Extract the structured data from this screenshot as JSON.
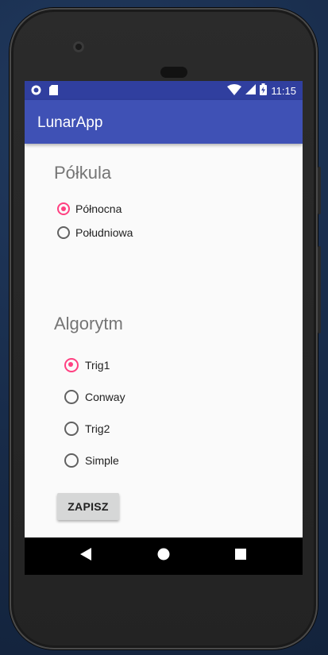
{
  "status_bar": {
    "time": "11:15",
    "left_icons": [
      "record-icon",
      "sd-card-icon"
    ],
    "right_icons": [
      "wifi-icon",
      "cell-signal-icon",
      "battery-icon"
    ]
  },
  "app_bar": {
    "title": "LunarApp",
    "color": "#3f51b5",
    "status_color": "#303f9f"
  },
  "hemisphere": {
    "title": "Półkula",
    "options": [
      {
        "label": "Północna",
        "checked": true
      },
      {
        "label": "Południowa",
        "checked": false
      }
    ]
  },
  "algorithm": {
    "title": "Algorytm",
    "options": [
      {
        "label": "Trig1",
        "checked": true
      },
      {
        "label": "Conway",
        "checked": false
      },
      {
        "label": "Trig2",
        "checked": false
      },
      {
        "label": "Simple",
        "checked": false
      }
    ]
  },
  "save_button": {
    "label": "ZAPISZ"
  },
  "nav_bar": {
    "icons": [
      "back-icon",
      "home-icon",
      "recents-icon"
    ]
  },
  "accent_color": "#ff4081"
}
